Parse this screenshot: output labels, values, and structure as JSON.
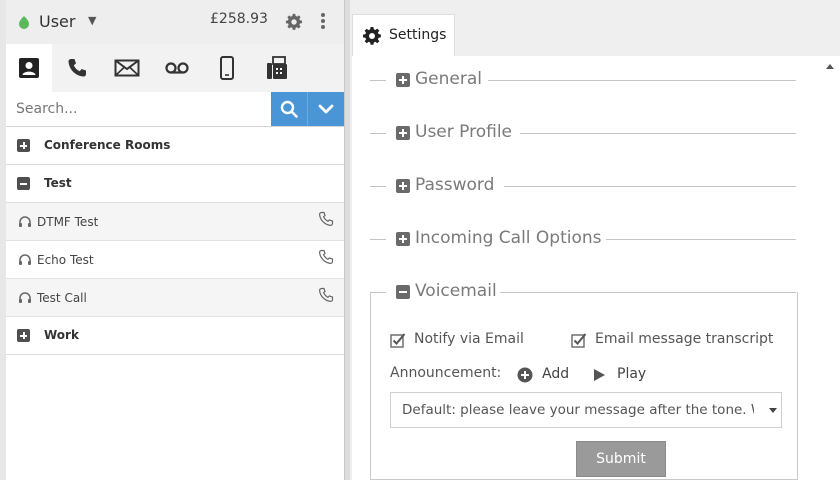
{
  "user": {
    "name": "User",
    "balance": "£258.93"
  },
  "contact_tabs": [
    {
      "name": "contacts-icon"
    },
    {
      "name": "phone-icon"
    },
    {
      "name": "mail-icon"
    },
    {
      "name": "voicemail-icon"
    },
    {
      "name": "mobile-icon"
    },
    {
      "name": "fax-icon"
    }
  ],
  "search": {
    "placeholder": "Search..."
  },
  "contacts": {
    "groups": [
      {
        "label": "Conference Rooms",
        "expanded": false
      },
      {
        "label": "Test",
        "expanded": true
      },
      {
        "label": "Work",
        "expanded": false
      }
    ],
    "test_items": [
      {
        "label": "DTMF Test"
      },
      {
        "label": "Echo Test"
      },
      {
        "label": "Test Call"
      }
    ]
  },
  "settings": {
    "tab_label": "Settings",
    "sections": [
      {
        "label": "General",
        "expanded": false
      },
      {
        "label": "User Profile",
        "expanded": false
      },
      {
        "label": "Password",
        "expanded": false
      },
      {
        "label": "Incoming Call Options",
        "expanded": false
      },
      {
        "label": "Voicemail",
        "expanded": true
      }
    ],
    "voicemail": {
      "notify_email_label": "Notify via Email",
      "notify_email_checked": true,
      "transcript_label": "Email message transcript",
      "transcript_checked": true,
      "announcement_label": "Announcement:",
      "add_label": "Add",
      "play_label": "Play",
      "announcement_value": "Default: please leave your message after the tone. W",
      "submit_label": "Submit"
    }
  },
  "colors": {
    "accent": "#4a95d6",
    "status_online": "#5cb85c",
    "submit_bg": "#9a9a9a"
  }
}
